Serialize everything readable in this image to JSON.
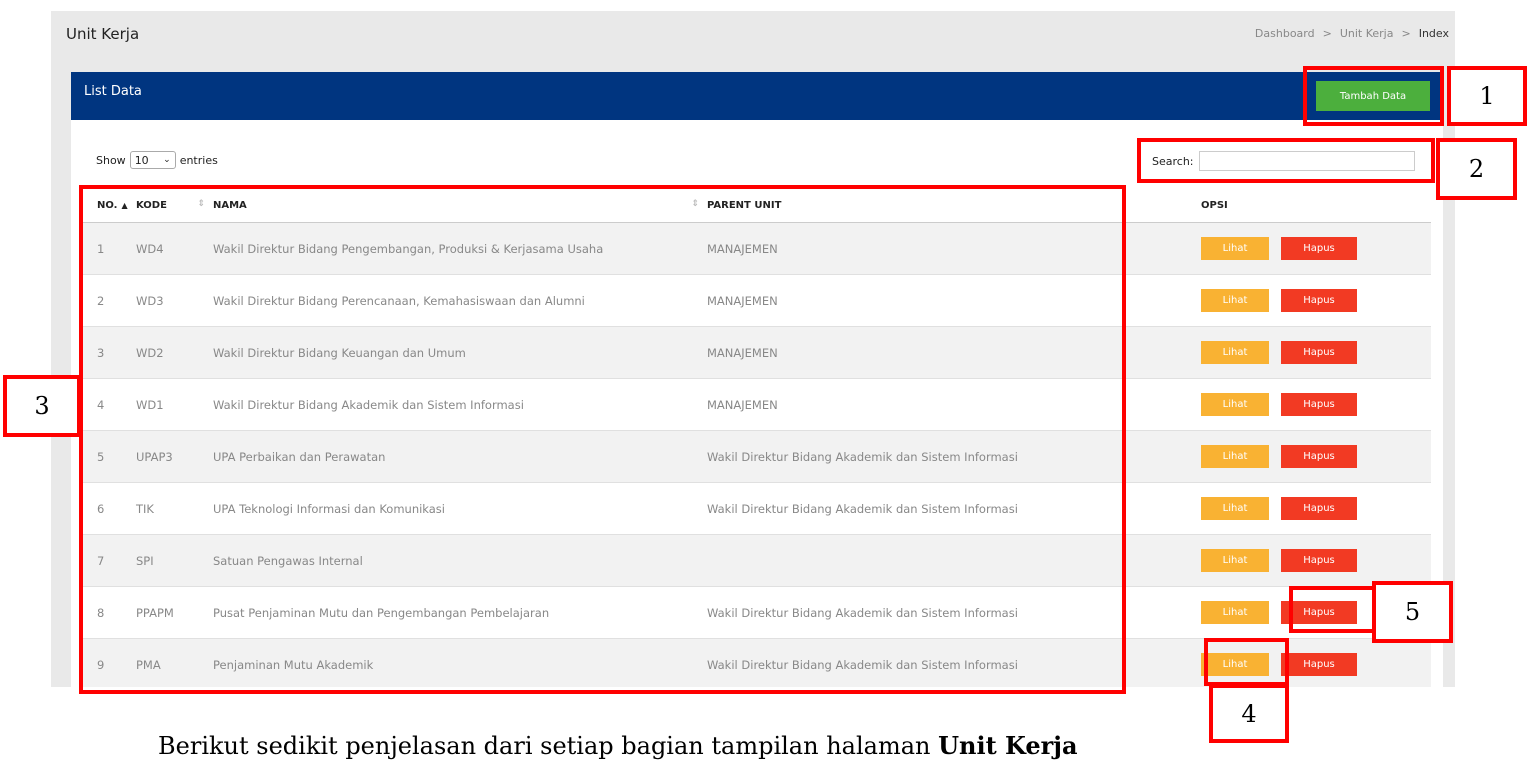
{
  "header": {
    "page_title": "Unit Kerja",
    "breadcrumb": [
      "Dashboard",
      "Unit Kerja",
      "Index"
    ],
    "breadcrumb_separator": ">"
  },
  "card": {
    "title": "List Data",
    "add_button": "Tambah Data"
  },
  "controls": {
    "show_label": "Show",
    "entries_value": "10",
    "entries_label": "entries",
    "search_label": "Search:",
    "search_value": ""
  },
  "table": {
    "columns": [
      "NO.",
      "KODE",
      "NAMA",
      "PARENT UNIT",
      "OPSI"
    ],
    "view_label": "Lihat",
    "delete_label": "Hapus",
    "rows": [
      {
        "no": "1",
        "kode": "WD4",
        "nama": "Wakil Direktur Bidang Pengembangan, Produksi & Kerjasama Usaha",
        "parent": "MANAJEMEN"
      },
      {
        "no": "2",
        "kode": "WD3",
        "nama": "Wakil Direktur Bidang Perencanaan, Kemahasiswaan dan Alumni",
        "parent": "MANAJEMEN"
      },
      {
        "no": "3",
        "kode": "WD2",
        "nama": "Wakil Direktur Bidang Keuangan dan Umum",
        "parent": "MANAJEMEN"
      },
      {
        "no": "4",
        "kode": "WD1",
        "nama": "Wakil Direktur Bidang Akademik dan Sistem Informasi",
        "parent": "MANAJEMEN"
      },
      {
        "no": "5",
        "kode": "UPAP3",
        "nama": "UPA Perbaikan dan Perawatan",
        "parent": "Wakil Direktur Bidang Akademik dan Sistem Informasi"
      },
      {
        "no": "6",
        "kode": "TIK",
        "nama": "UPA Teknologi Informasi dan Komunikasi",
        "parent": "Wakil Direktur Bidang Akademik dan Sistem Informasi"
      },
      {
        "no": "7",
        "kode": "SPI",
        "nama": "Satuan Pengawas Internal",
        "parent": ""
      },
      {
        "no": "8",
        "kode": "PPAPM",
        "nama": "Pusat Penjaminan Mutu dan Pengembangan Pembelajaran",
        "parent": "Wakil Direktur Bidang Akademik dan Sistem Informasi"
      },
      {
        "no": "9",
        "kode": "PMA",
        "nama": "Penjaminan Mutu Akademik",
        "parent": "Wakil Direktur Bidang Akademik dan Sistem Informasi"
      }
    ]
  },
  "annotations": {
    "labels": [
      "1",
      "2",
      "3",
      "4",
      "5"
    ],
    "color": "#ff0000"
  },
  "caption": {
    "text": "Berikut sedikit penjelasan dari setiap bagian tampilan halaman ",
    "bold": "Unit Kerja"
  },
  "colors": {
    "header_bg": "#003580",
    "add_button": "#4caf3d",
    "view_button": "#f9b233",
    "delete_button": "#f23a23"
  }
}
